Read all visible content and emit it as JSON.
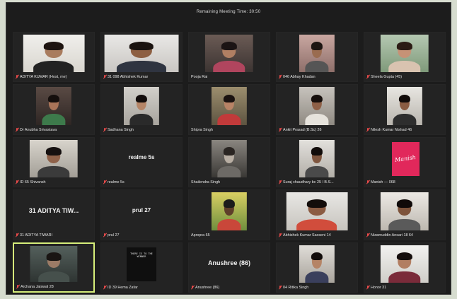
{
  "meeting": {
    "banner": "Remaining Meeting Time: 30:50"
  },
  "colors": {
    "window_bg": "#1c1c1c",
    "active_speaker_border": "#d6ee7a",
    "muted_mic": "#e84a4a"
  },
  "participants": [
    {
      "label": "ADITYA KUMAR (Host, me)",
      "muted": true
    },
    {
      "label": "31 098 Abhishek Kumar",
      "muted": true
    },
    {
      "label": "Pooja Rai",
      "muted": false
    },
    {
      "label": "046 Abhay Khadan",
      "muted": true
    },
    {
      "label": "Sheela Gupta (45)",
      "muted": true
    },
    {
      "label": "Dr Anubha Srivastava",
      "muted": true
    },
    {
      "label": "Sadhana Singh",
      "muted": true
    },
    {
      "label": "Shipra Singh",
      "muted": false
    },
    {
      "label": "Ankit Prasad (B.Sc) 26",
      "muted": true
    },
    {
      "label": "Nilesh Kumar Nishad 46",
      "muted": true
    },
    {
      "label": "ID 65 Shivansh",
      "muted": true
    },
    {
      "label": "realme 5s",
      "muted": true,
      "display_text": "realme 5s"
    },
    {
      "label": "Shailendra Singh",
      "muted": false
    },
    {
      "label": "Suraj chaudhary bc 25 I B.S...",
      "muted": true
    },
    {
      "label": "Manish — 068",
      "muted": true,
      "display_text": "Manish"
    },
    {
      "label": "31 ADITYA TIWARI",
      "muted": true,
      "display_text": "31 ADITYA TIW..."
    },
    {
      "label": "prul 27",
      "muted": true,
      "display_text": "prul 27"
    },
    {
      "label": "Apropra 65",
      "muted": false
    },
    {
      "label": "Abhishek Kumar Saxseni 14",
      "muted": true
    },
    {
      "label": "Nizamuddin Ansari 18 64",
      "muted": true
    },
    {
      "label": "Archana Jaiswal 28",
      "muted": true,
      "active": true
    },
    {
      "label": "ID 39 Hema Zafar",
      "muted": true,
      "poster_text": "THERE IS TO THE WINNER"
    },
    {
      "label": "Anushree (86)",
      "muted": true,
      "display_text": "Anushree (86)"
    },
    {
      "label": "04 Ritika Singh",
      "muted": true
    },
    {
      "label": "Honor 31",
      "muted": true
    }
  ]
}
